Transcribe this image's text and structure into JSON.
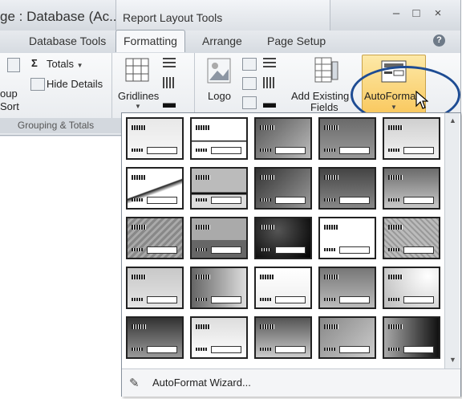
{
  "window": {
    "title": "ge : Database (Ac...",
    "context_tab": "Report Layout Tools",
    "minimize": "–",
    "maximize": "□",
    "close": "×"
  },
  "tabs": [
    "Database Tools",
    "Formatting",
    "Arrange",
    "Page Setup"
  ],
  "active_tab": "Formatting",
  "help": "?",
  "ribbon": {
    "grouping": {
      "totals": "Totals",
      "hide_details": "Hide Details",
      "group_top": "oup",
      "group_bottom": "Sort",
      "label": "Grouping & Totals"
    },
    "gridlines": {
      "label": "Gridlines"
    },
    "controls": {
      "logo": "Logo",
      "add_existing_fields_1": "Add Existing",
      "add_existing_fields_2": "Fields",
      "autoformat": "AutoFormat"
    }
  },
  "gallery": {
    "rows": 5,
    "cols": 5,
    "wizard_label": "AutoFormat Wizard..."
  }
}
